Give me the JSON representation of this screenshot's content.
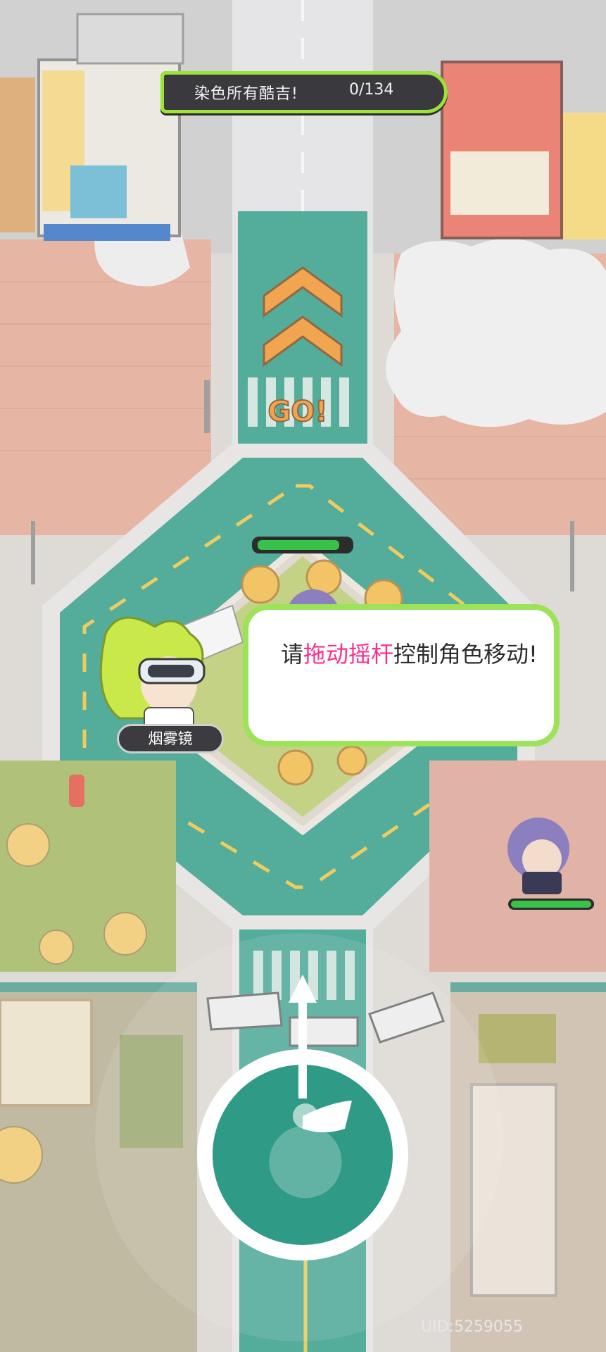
{
  "quest": {
    "label": "染色所有酷吉!",
    "progress": "0/134"
  },
  "direction_sign": "GO!",
  "dialog": {
    "speaker_name": "烟雾镜",
    "text_before": "请",
    "text_highlight": "拖动摇杆",
    "text_after": "控制角色移动!"
  },
  "joystick": {
    "label": "movement-joystick"
  },
  "uid": "UID:5259055",
  "colors": {
    "quest_bg": "#3a3a3e",
    "quest_border": "#9be23a",
    "dialog_border": "#9ce35a",
    "highlight": "#ff2d8b",
    "road": "#2f9a86",
    "health_green": "#38c24a"
  }
}
